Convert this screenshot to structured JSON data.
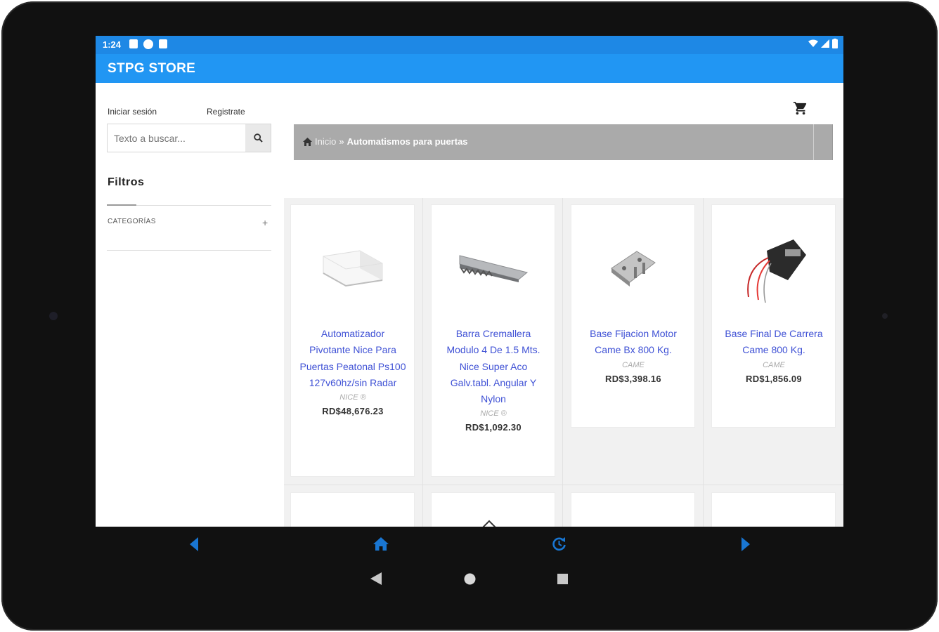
{
  "status_bar": {
    "time": "1:24"
  },
  "app": {
    "title": "STPG STORE"
  },
  "auth": {
    "login_label": "Iniciar sesión",
    "register_label": "Registrate"
  },
  "search": {
    "placeholder": "Texto a buscar..."
  },
  "filters": {
    "title": "Filtros",
    "category_label": "CATEGORÍAS",
    "expand_symbol": "+"
  },
  "breadcrumb": {
    "home": "Inicio",
    "separator": "»",
    "current": "Automatismos para puertas"
  },
  "products": [
    {
      "name": "Automatizador Pivotante Nice Para Puertas Peatonal Ps100 127v60hz/sin Radar",
      "brand": "NICE ®",
      "price": "RD$48,676.23"
    },
    {
      "name": "Barra Cremallera Modulo 4 De 1.5 Mts. Nice Super Aco Galv.tabl. Angular Y Nylon",
      "brand": "NICE ®",
      "price": "RD$1,092.30"
    },
    {
      "name": "Base Fijacion Motor Came Bx 800 Kg.",
      "brand": "CAME",
      "price": "RD$3,398.16"
    },
    {
      "name": "Base Final De Carrera Came 800 Kg.",
      "brand": "CAME",
      "price": "RD$1,856.09"
    }
  ],
  "colors": {
    "status_bar": "#1e88e5",
    "app_bar": "#2196f3",
    "product_link": "#3f51d5",
    "breadcrumb_bg": "#aaaaaa",
    "nav_blue": "#1976d2"
  },
  "nav_icons": [
    "back-arrow-icon",
    "home-icon",
    "refresh-icon",
    "forward-arrow-icon"
  ],
  "system_nav_icons": [
    "system-back-icon",
    "system-home-icon",
    "system-recents-icon"
  ]
}
